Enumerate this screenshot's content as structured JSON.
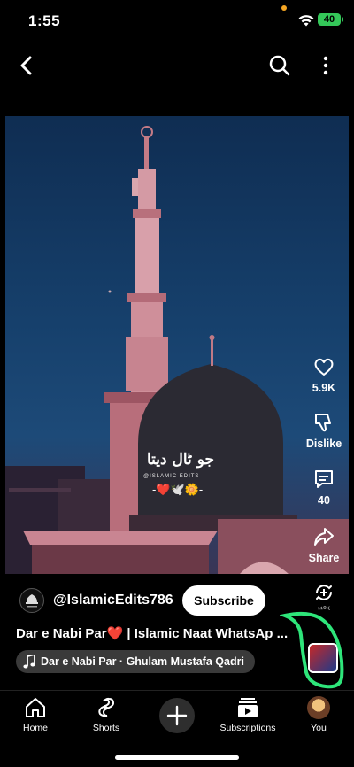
{
  "status_bar": {
    "time": "1:55",
    "battery": "40"
  },
  "top_bar": {
    "back_icon": "chevron-left-icon",
    "search_icon": "search-icon",
    "more_icon": "more-vertical-icon"
  },
  "video": {
    "overlay_text": "جو ٹال دیتا",
    "overlay_credit": "@ISLAMIC EDITS",
    "overlay_emoji": "-❤️🕊️🌼-"
  },
  "actions": {
    "like_count": "5.9K",
    "dislike_label": "Dislike",
    "comment_count": "40",
    "share_label": "Share",
    "remix_count": "¹¹⁰ᴷ"
  },
  "channel": {
    "handle": "@IslamicEdits786",
    "subscribe_label": "Subscribe"
  },
  "title": "Dar e Nabi Par❤️ | Islamic Naat WhatsAp ...",
  "music": {
    "label": "Dar e Nabi Par · Ghulam Mustafa Qadri"
  },
  "bottom_nav": {
    "items": [
      {
        "label": "Home"
      },
      {
        "label": "Shorts"
      },
      {
        "label": ""
      },
      {
        "label": "Subscriptions"
      },
      {
        "label": "You"
      }
    ]
  },
  "colors": {
    "highlight_ring": "#2ee57a",
    "subscribe_bg": "#ffffff",
    "battery": "#34c759"
  }
}
